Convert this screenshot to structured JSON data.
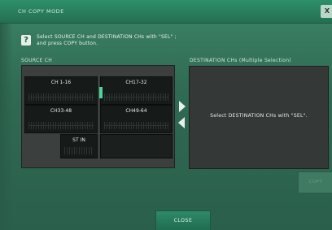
{
  "window": {
    "title": "CH COPY MODE",
    "close_label": "X"
  },
  "help": {
    "icon": "?",
    "line1": "Select SOURCE CH and DESTINATION CHs with \"SEL\" ;",
    "line2": "and press COPY button."
  },
  "source": {
    "label": "SOURCE CH",
    "blocks": [
      {
        "label": "CH 1-16"
      },
      {
        "label": "CH17-32"
      },
      {
        "label": "CH33-48"
      },
      {
        "label": "CH49-64"
      },
      {
        "label": "ST IN"
      }
    ]
  },
  "destination": {
    "label": "DESTINATION CHs (Multiple Selection)",
    "message": "Select DESTINATION CHs with \"SEL\"."
  },
  "buttons": {
    "copy": "COPY",
    "close": "CLOSE"
  },
  "colors": {
    "accent": "#2f8a69",
    "panel": "#3b3f3e",
    "indicator": "#46d99a"
  }
}
